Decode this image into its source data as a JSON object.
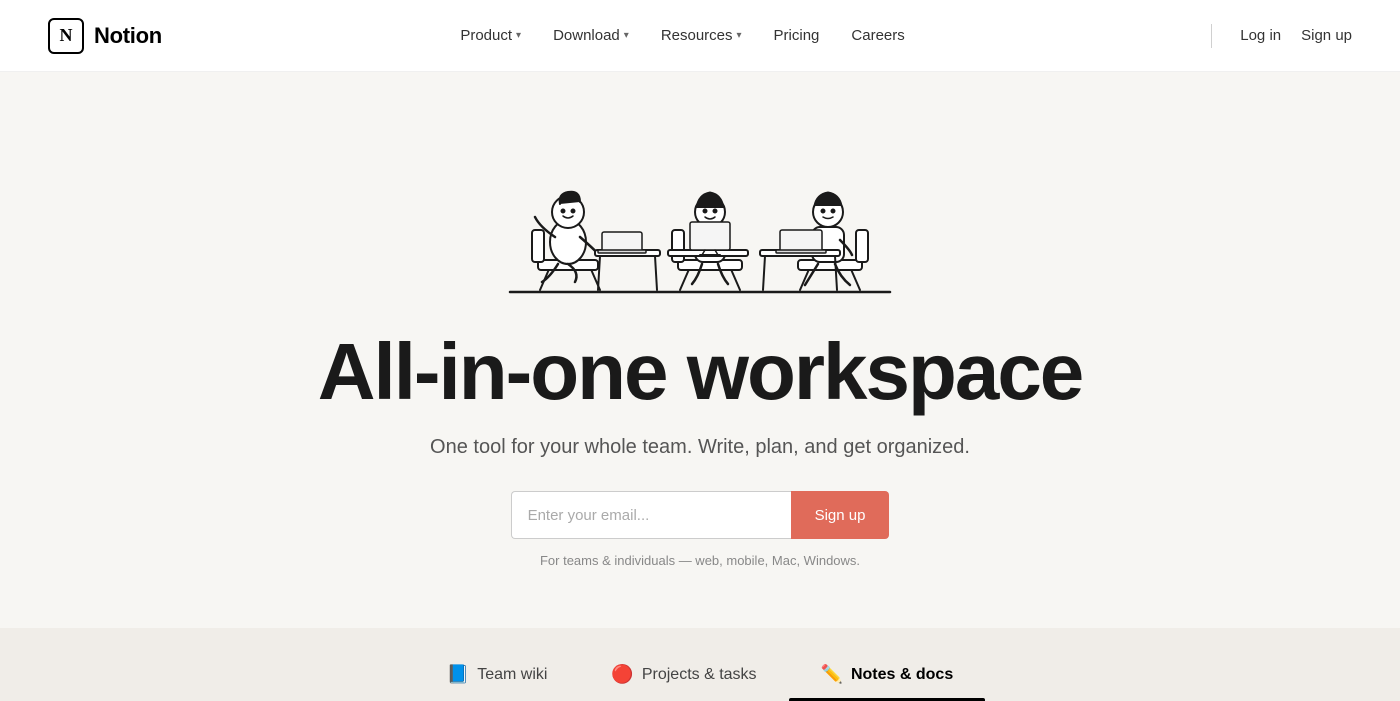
{
  "nav": {
    "logo_text": "Notion",
    "logo_letter": "N",
    "items": [
      {
        "label": "Product",
        "has_dropdown": true
      },
      {
        "label": "Download",
        "has_dropdown": true
      },
      {
        "label": "Resources",
        "has_dropdown": true
      },
      {
        "label": "Pricing",
        "has_dropdown": false
      },
      {
        "label": "Careers",
        "has_dropdown": false
      }
    ],
    "login_label": "Log in",
    "signup_label": "Sign up"
  },
  "hero": {
    "title": "All-in-one workspace",
    "subtitle": "One tool for your whole team. Write, plan, and get organized.",
    "email_placeholder": "Enter your email...",
    "signup_button": "Sign up",
    "note": "For teams & individuals — web, mobile, Mac, Windows."
  },
  "tabs": [
    {
      "emoji": "📘",
      "label": "Team wiki",
      "active": false
    },
    {
      "emoji": "🔴",
      "label": "Projects & tasks",
      "active": false
    },
    {
      "emoji": "✏️",
      "label": "Notes & docs",
      "active": true
    }
  ]
}
